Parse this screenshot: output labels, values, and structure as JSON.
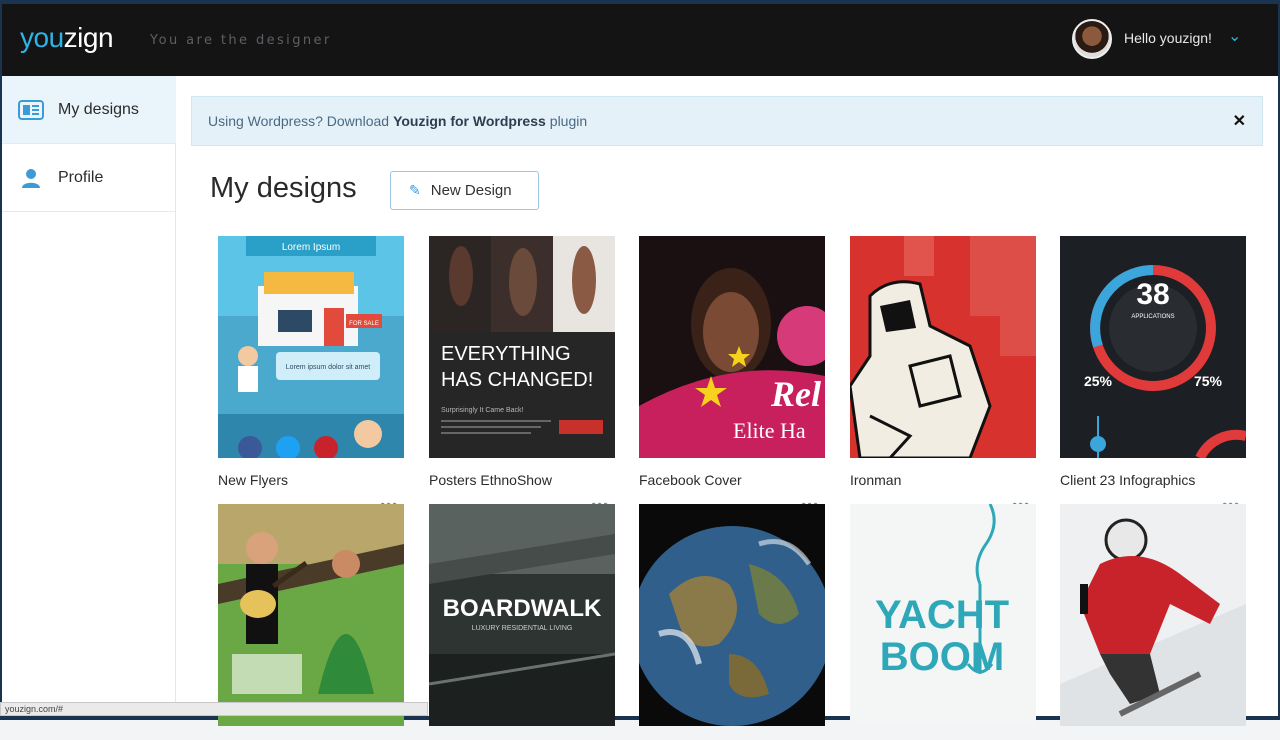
{
  "header": {
    "logo_you": "you",
    "logo_zign": "zign",
    "tagline": "You are the designer",
    "greeting": "Hello youzign!"
  },
  "sidebar": {
    "items": [
      {
        "label": "My designs",
        "icon": "designs-icon",
        "active": true
      },
      {
        "label": "Profile",
        "icon": "user-icon",
        "active": false
      }
    ]
  },
  "notice": {
    "prefix": "Using Wordpress? Download",
    "bold": "Youzign for Wordpress",
    "suffix": "plugin"
  },
  "main": {
    "title": "My designs",
    "new_button": "New Design"
  },
  "designs": [
    {
      "name": "New Flyers",
      "thumb_text": [
        "Lorem Ipsum",
        "FOR SALE",
        "Lorem ipsum dolor sit amet"
      ]
    },
    {
      "name": "Posters EthnoShow",
      "thumb_text": [
        "EVERYTHING",
        "HAS CHANGED!",
        "Surprisingly It Came Back!"
      ]
    },
    {
      "name": "Facebook Cover",
      "thumb_text": [
        "Rel",
        "Elite Ha"
      ]
    },
    {
      "name": "Ironman",
      "thumb_text": []
    },
    {
      "name": "Client 23 Infographics",
      "thumb_text": [
        "38",
        "APPLICATIONS",
        "25%",
        "75%"
      ]
    },
    {
      "name": "",
      "thumb_text": []
    },
    {
      "name": "",
      "thumb_text": [
        "BOARDWALK",
        "LUXURY RESIDENTIAL LIVING"
      ]
    },
    {
      "name": "",
      "thumb_text": []
    },
    {
      "name": "",
      "thumb_text": [
        "YACHT",
        "BOOM"
      ]
    },
    {
      "name": "",
      "thumb_text": []
    }
  ],
  "status_url": "youzign.com/#",
  "colors": {
    "brand": "#2fb3e6",
    "accent": "#3a9bd6",
    "topbar": "#141414"
  }
}
